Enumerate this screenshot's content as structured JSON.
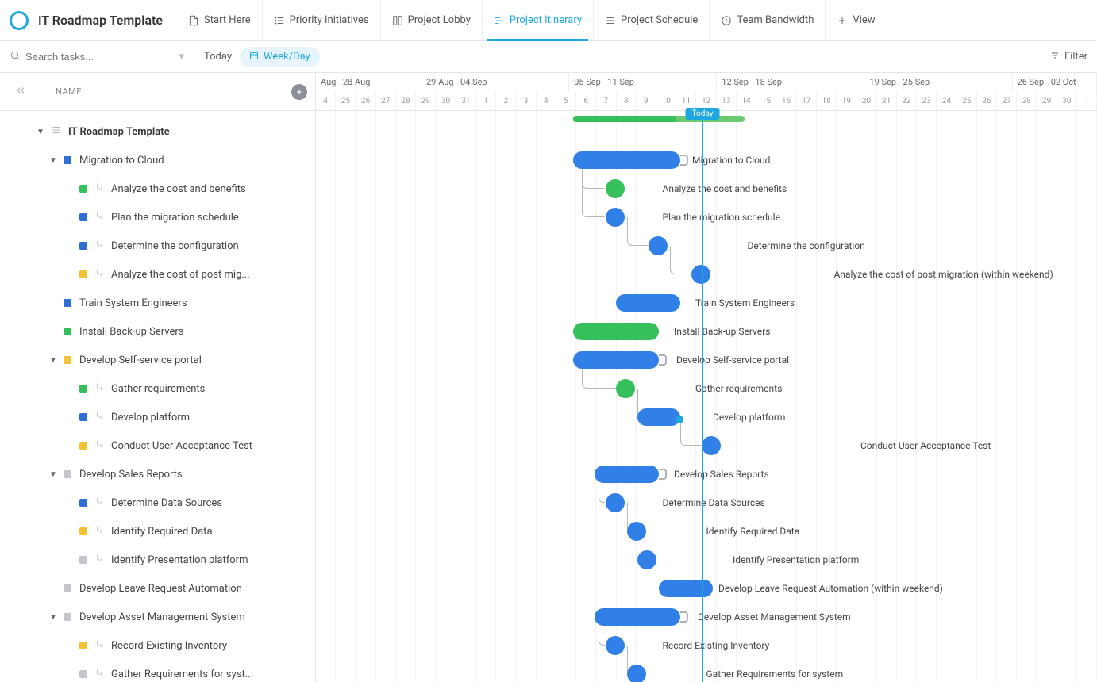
{
  "pageTitle": "IT Roadmap Template",
  "tabs": [
    {
      "label": "Start Here",
      "icon": "doc",
      "active": false
    },
    {
      "label": "Priority Initiatives",
      "icon": "list",
      "active": false
    },
    {
      "label": "Project Lobby",
      "icon": "board",
      "active": false
    },
    {
      "label": "Project Itinerary",
      "icon": "gantt",
      "active": true
    },
    {
      "label": "Project Schedule",
      "icon": "calendar",
      "active": false
    },
    {
      "label": "Team Bandwidth",
      "icon": "workload",
      "active": false
    },
    {
      "label": "View",
      "icon": "plus",
      "active": false
    }
  ],
  "search": {
    "placeholder": "Search tasks..."
  },
  "today": "Today",
  "weekday": "Week/Day",
  "filter": "Filter",
  "nameHeader": "NAME",
  "todayChip": "Today",
  "timeline": {
    "dayWidthPx": 27,
    "startDay": 24,
    "weeks": [
      {
        "label": "Aug - 28 Aug",
        "days": 5
      },
      {
        "label": "29 Aug - 04 Sep",
        "days": 7
      },
      {
        "label": "05 Sep - 11 Sep",
        "days": 7
      },
      {
        "label": "12 Sep - 18 Sep",
        "days": 7
      },
      {
        "label": "19 Sep - 25 Sep",
        "days": 7
      },
      {
        "label": "26 Sep - 02 Oct",
        "days": 4
      }
    ],
    "days": [
      "4",
      "25",
      "26",
      "27",
      "28",
      "29",
      "30",
      "31",
      "1",
      "2",
      "3",
      "4",
      "5",
      "6",
      "7",
      "8",
      "9",
      "10",
      "11",
      "12",
      "13",
      "14",
      "15",
      "16",
      "17",
      "18",
      "19",
      "20",
      "21",
      "22",
      "23",
      "24",
      "25",
      "26",
      "27",
      "28",
      "29",
      "30",
      "1"
    ],
    "todayIndex": 18
  },
  "progress": {
    "startIndex": 12,
    "width": 8,
    "fillPct": 60
  },
  "tree": [
    {
      "level": 0,
      "label": "IT Roadmap Template",
      "caret": true,
      "listIcon": true
    },
    {
      "level": 1,
      "label": "Migration to Cloud",
      "caret": true,
      "dot": "blue"
    },
    {
      "level": 2,
      "label": "Analyze the cost and benefits",
      "dot": "green",
      "sub": true
    },
    {
      "level": 2,
      "label": "Plan the migration schedule",
      "dot": "blue",
      "sub": true
    },
    {
      "level": 2,
      "label": "Determine the configuration",
      "dot": "blue",
      "sub": true
    },
    {
      "level": 2,
      "label": "Analyze the cost of post mig...",
      "dot": "yellow",
      "sub": true
    },
    {
      "level": 1,
      "label": "Train System Engineers",
      "dot": "blue"
    },
    {
      "level": 1,
      "label": "Install Back-up Servers",
      "dot": "green"
    },
    {
      "level": 1,
      "label": "Develop Self-service portal",
      "caret": true,
      "dot": "yellow"
    },
    {
      "level": 2,
      "label": "Gather requirements",
      "dot": "green",
      "sub": true
    },
    {
      "level": 2,
      "label": "Develop platform",
      "dot": "blue",
      "sub": true
    },
    {
      "level": 2,
      "label": "Conduct User Acceptance Test",
      "dot": "yellow",
      "sub": true
    },
    {
      "level": 1,
      "label": "Develop Sales Reports",
      "caret": true,
      "dot": "grey"
    },
    {
      "level": 2,
      "label": "Determine Data Sources",
      "dot": "blue",
      "sub": true
    },
    {
      "level": 2,
      "label": "Identify Required Data",
      "dot": "yellow",
      "sub": true
    },
    {
      "level": 2,
      "label": "Identify Presentation platform",
      "dot": "grey",
      "sub": true
    },
    {
      "level": 1,
      "label": "Develop Leave Request Automation",
      "dot": "grey"
    },
    {
      "level": 1,
      "label": "Develop Asset Management System",
      "caret": true,
      "dot": "grey"
    },
    {
      "level": 2,
      "label": "Record Existing Inventory",
      "dot": "yellow",
      "sub": true
    },
    {
      "level": 2,
      "label": "Gather Requirements for syst...",
      "dot": "grey",
      "sub": true
    }
  ],
  "bars": [
    {
      "row": 1,
      "start": 12,
      "width": 5,
      "color": "blue",
      "bracket": true,
      "label": "Migration to Cloud",
      "labelOffset": 150
    },
    {
      "row": 2,
      "start": 13.5,
      "width": 1,
      "color": "green",
      "circle": true,
      "label": "Analyze the cost and benefits",
      "labelOffset": 72,
      "conn": {
        "fromRow": 1,
        "fromX": 12.4
      }
    },
    {
      "row": 3,
      "start": 13.5,
      "width": 1,
      "color": "blue",
      "circle": true,
      "label": "Plan the migration schedule",
      "labelOffset": 72,
      "conn": {
        "fromRow": 1,
        "fromX": 12.4
      }
    },
    {
      "row": 4,
      "start": 15.5,
      "width": 1,
      "color": "blue",
      "circle": true,
      "label": "Determine the configuration",
      "labelOffset": 125,
      "conn": {
        "fromRow": 3,
        "fromX": 14.5
      }
    },
    {
      "row": 5,
      "start": 17.5,
      "width": 1,
      "color": "blue",
      "circle": true,
      "label": "Analyze the cost of post migration (within weekend)",
      "labelOffset": 180,
      "conn": {
        "fromRow": 4,
        "fromX": 16.5
      }
    },
    {
      "row": 6,
      "start": 14,
      "width": 3,
      "color": "blue",
      "label": "Train System Engineers",
      "labelOffset": 100
    },
    {
      "row": 7,
      "start": 12,
      "width": 4,
      "color": "green",
      "label": "Install Back-up Servers",
      "labelOffset": 127
    },
    {
      "row": 8,
      "start": 12,
      "width": 4,
      "color": "blue",
      "bracket": true,
      "label": "Develop Self-service portal",
      "labelOffset": 130
    },
    {
      "row": 9,
      "start": 14,
      "width": 1,
      "color": "green",
      "circle": true,
      "label": "Gather requirements",
      "labelOffset": 100,
      "conn": {
        "fromRow": 8,
        "fromX": 12.4
      }
    },
    {
      "row": 10,
      "start": 15,
      "width": 2,
      "color": "blue",
      "diamond": true,
      "label": "Develop platform",
      "labelOffset": 95,
      "conn": {
        "fromRow": 9,
        "fromX": 15
      }
    },
    {
      "row": 11,
      "start": 18,
      "width": 1,
      "color": "blue",
      "circle": true,
      "label": "Conduct User Acceptance Test",
      "labelOffset": 200,
      "conn": {
        "fromRow": 10,
        "fromX": 17
      }
    },
    {
      "row": 12,
      "start": 13,
      "width": 3,
      "color": "blue",
      "bracket": true,
      "label": "Develop Sales Reports",
      "labelOffset": 100
    },
    {
      "row": 13,
      "start": 13.5,
      "width": 1,
      "color": "blue",
      "circle": true,
      "label": "Determine Data Sources",
      "labelOffset": 72,
      "conn": {
        "fromRow": 12,
        "fromX": 13.2
      }
    },
    {
      "row": 14,
      "start": 14.5,
      "width": 1,
      "color": "blue",
      "circle": true,
      "label": "Identify Required Data",
      "labelOffset": 100,
      "conn": {
        "fromRow": 13,
        "fromX": 14.5
      }
    },
    {
      "row": 15,
      "start": 15,
      "width": 1,
      "color": "blue",
      "circle": true,
      "label": "Identify Presentation platform",
      "labelOffset": 120,
      "conn": {
        "fromRow": 14,
        "fromX": 15.5
      }
    },
    {
      "row": 16,
      "start": 16,
      "width": 2.5,
      "color": "blue",
      "label": "Develop Leave Request Automation (within weekend)",
      "labelOffset": 75
    },
    {
      "row": 17,
      "start": 13,
      "width": 4,
      "color": "blue",
      "bracket": true,
      "label": "Develop Asset Management System",
      "labelOffset": 130
    },
    {
      "row": 18,
      "start": 13.5,
      "width": 1,
      "color": "blue",
      "circle": true,
      "label": "Record Existing Inventory",
      "labelOffset": 72,
      "conn": {
        "fromRow": 17,
        "fromX": 13.2
      }
    },
    {
      "row": 19,
      "start": 14.5,
      "width": 1,
      "color": "blue",
      "circle": true,
      "label": "Gather Requirements for system",
      "labelOffset": 100,
      "conn": {
        "fromRow": 18,
        "fromX": 14.5
      }
    }
  ]
}
